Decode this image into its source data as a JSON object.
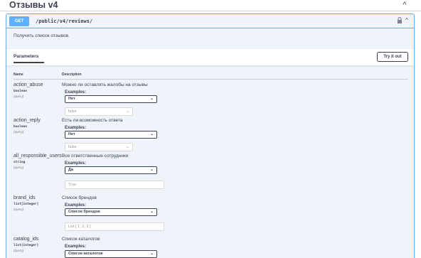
{
  "section": {
    "title": "Отзывы v4",
    "toggle_glyph": "^"
  },
  "operation": {
    "method": "GET",
    "path": "/public/v4/reviews/",
    "collapse_glyph": "^",
    "description": "Получить список отзывов."
  },
  "params_bar": {
    "tab": "Parameters",
    "try_label": "Try it out"
  },
  "columns": {
    "name": "Name",
    "description": "Description"
  },
  "params": [
    {
      "name": "action_abuse",
      "type": "boolean",
      "in": "(query)",
      "description": "Можно ли оставлять жалобы на отзывы",
      "examples_label": "Examples:",
      "example": "Нет",
      "input": "false"
    },
    {
      "name": "action_reply",
      "type": "boolean",
      "in": "(query)",
      "description": "Есть ли возможность ответа",
      "examples_label": "Examples:",
      "example": "Нет",
      "input": "false"
    },
    {
      "name": "all_responsible_users",
      "type": "string",
      "in": "(query)",
      "description": "Все ответственные сотрудники",
      "examples_label": "Examples:",
      "example": "Да",
      "input": "True"
    },
    {
      "name": "brand_ids",
      "type": "list[integer]",
      "in": "(query)",
      "description": "Список брендов",
      "examples_label": "Examples:",
      "example": "Список брендов",
      "input": "List [ 1, 2, 3 ]"
    },
    {
      "name": "catalog_ids",
      "type": "list[integer]",
      "in": "(query)",
      "description": "Список каталогов",
      "examples_label": "Examples:",
      "example": "Список каталогов"
    }
  ]
}
